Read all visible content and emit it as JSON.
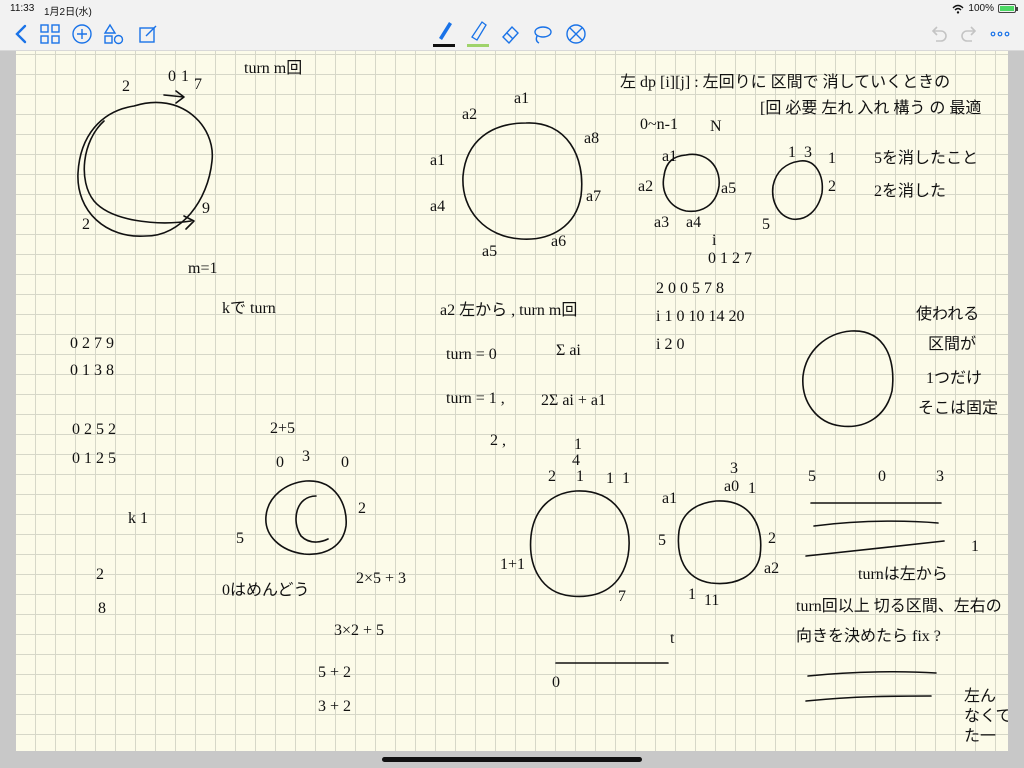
{
  "status_bar": {
    "time": "11:33",
    "date": "1月2日(水)",
    "battery_percent": "100%",
    "battery_level": 1.0,
    "wifi_icon": "wifi-icon",
    "battery_icon": "battery-icon"
  },
  "toolbar": {
    "left_icons": [
      "back-chevron-icon",
      "grid-icon",
      "add-icon",
      "shapes-icon",
      "edit-icon"
    ],
    "tools": [
      "pen-icon",
      "highlighter-icon",
      "eraser-icon",
      "lasso-icon",
      "no-icon"
    ],
    "active_tool": "pen",
    "pen_color": "#111111",
    "highlighter_color": "#9fd36b",
    "right_icons": [
      "undo-icon",
      "redo-icon",
      "more-icon"
    ],
    "accent": "#1a73e8"
  },
  "notes": {
    "top_left": [
      "turn m回",
      "2",
      "0",
      "1",
      "7",
      "2",
      "9",
      "m=1"
    ],
    "k_turn": "kで turn",
    "table_a": [
      "0 2 7 9",
      "0 1 3 8"
    ],
    "table_b": [
      "0 2 5 2",
      "0 1 2 5"
    ],
    "k1": "k 1",
    "col_28": [
      "2",
      "8"
    ],
    "example": [
      "2+5",
      "0",
      "3",
      "0",
      "5",
      "2",
      "0はめんどう"
    ],
    "math_lines": [
      "2×5 + 3",
      "3×2 + 5",
      "5 + 2",
      "3 + 2"
    ],
    "circle_labels": [
      "a1",
      "a2",
      "a8",
      "a1",
      "a4",
      "a7",
      "a6",
      "a5"
    ],
    "turn_notes": [
      "a2 左から , turn m回",
      "turn = 0",
      "Σ ai",
      "turn = 1 ,",
      "2Σ ai + a1",
      "2 ,"
    ],
    "dp_notes": [
      "左 dp [i][j] : 左回りに 区間で 消していくときの",
      "[回 必要 左れ 入れ 構う の 最適",
      "0~n-1",
      "N"
    ],
    "small_circle": [
      "a1",
      "a2",
      "a5",
      "a3",
      "a4"
    ],
    "circle2": [
      "1",
      "3",
      "1",
      "2",
      "5",
      "5を消したこと",
      "2を消した"
    ],
    "dp_table": [
      "i",
      "0 1 2 7",
      "2 0 0 5 7 8",
      "i 1 0 10 14 20",
      "i 2 0"
    ],
    "right_circle": [
      "使われる",
      "区間が",
      "1つだけ",
      "そこは固定"
    ],
    "bottom_circles": [
      "1",
      "4",
      "2",
      "1",
      "1",
      "1",
      "1+1",
      "7",
      "a1",
      "a0",
      "3",
      "1",
      "5",
      "2",
      "a2",
      "1",
      "11"
    ],
    "timeline": [
      "0",
      "t"
    ],
    "right_bottom": [
      "5",
      "0",
      "3",
      "1",
      "turnは左から",
      "turn回以上 切る区間、左右の",
      "向きを決めたら fix ?",
      "左ん",
      "なくて",
      "た一"
    ]
  }
}
